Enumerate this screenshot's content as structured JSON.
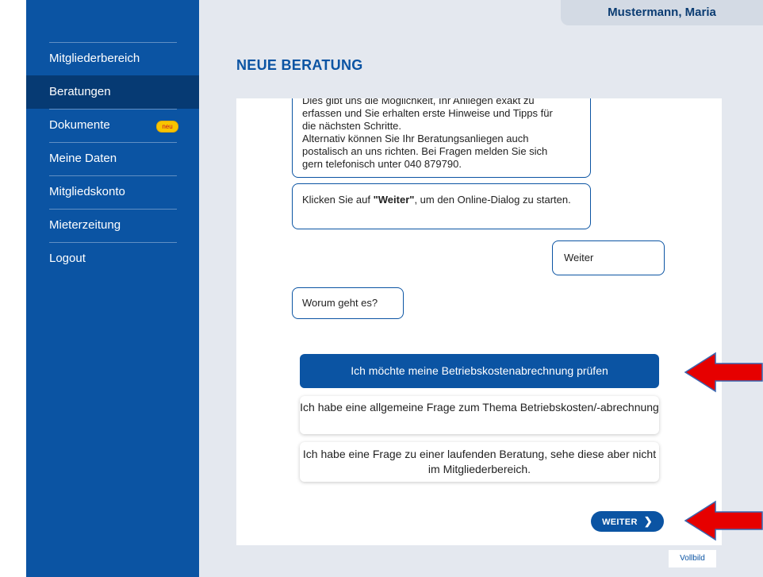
{
  "user": {
    "name": "Mustermann, Maria"
  },
  "sidebar": {
    "items": [
      {
        "label": "Mitgliederbereich"
      },
      {
        "label": "Beratungen",
        "active": true
      },
      {
        "label": "Dokumente",
        "badge": "neu"
      },
      {
        "label": "Meine Daten"
      },
      {
        "label": "Mitgliedskonto"
      },
      {
        "label": "Mieterzeitung"
      },
      {
        "label": "Logout"
      }
    ]
  },
  "page": {
    "title": "NEUE BERATUNG"
  },
  "chat": {
    "bubble1_lines": [
      "Dies gibt uns die Möglichkeit, Ihr Anliegen exakt zu",
      "erfassen und Sie erhalten erste Hinweise und Tipps für",
      "die nächsten Schritte.",
      "Alternativ können Sie Ihr Beratungsanliegen auch",
      "postalisch an uns richten. Bei Fragen melden Sie sich",
      "gern telefonisch unter 040 879790."
    ],
    "bubble2": {
      "prefix": "Klicken Sie auf ",
      "bold": "\"Weiter\"",
      "suffix": ", um den Online-Dialog zu starten."
    },
    "user_reply": "Weiter",
    "question": "Worum geht es?"
  },
  "options": [
    {
      "label": "Ich möchte meine Betriebskostenabrechnung prüfen",
      "selected": true
    },
    {
      "label": "Ich habe eine allgemeine Frage zum Thema Betriebskosten/-abrechnung"
    },
    {
      "label": "Ich habe eine Frage zu einer laufenden Beratung, sehe diese aber nicht im Mitgliederbereich."
    }
  ],
  "buttons": {
    "weiter": "WEITER",
    "vollbild": "Vollbild"
  },
  "icons": {
    "chevron": "chevron-right-icon",
    "annotation": "red-arrow-left-icon"
  },
  "colors": {
    "sidebar": "#0b54a3",
    "sidebar_active": "#063a73",
    "main_bg": "#e4e8ef",
    "accent": "#0b54a3",
    "badge": "#f7c400",
    "annotation": "#e60000"
  }
}
